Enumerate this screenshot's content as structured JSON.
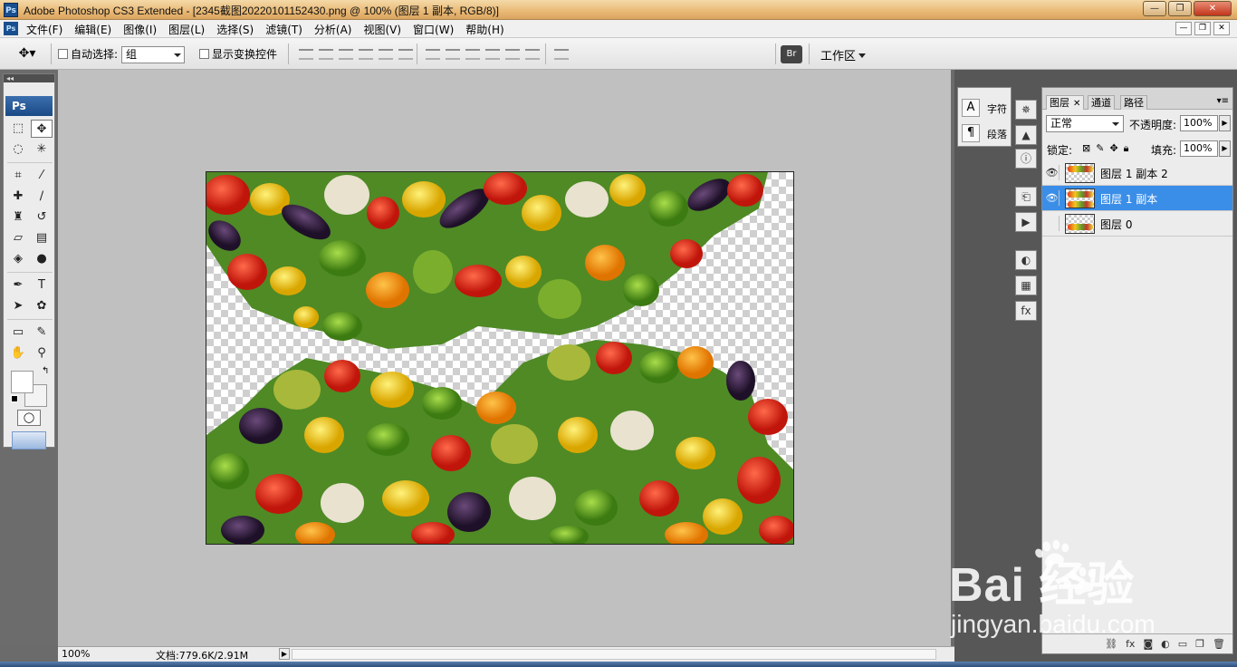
{
  "window": {
    "title": "Adobe Photoshop CS3 Extended - [2345截图20220101152430.png @ 100% (图层 1 副本, RGB/8)]",
    "app_icon": "Ps",
    "controls": [
      "—",
      "❐",
      "✕"
    ]
  },
  "menubar": {
    "items": [
      "文件(F)",
      "编辑(E)",
      "图像(I)",
      "图层(L)",
      "选择(S)",
      "滤镜(T)",
      "分析(A)",
      "视图(V)",
      "窗口(W)",
      "帮助(H)"
    ],
    "doc_controls": [
      "—",
      "❐",
      "✕"
    ]
  },
  "options": {
    "auto_select_label": "自动选择:",
    "auto_select_value": "组",
    "show_transform_label": "显示变换控件",
    "workspace_label": "工作区"
  },
  "toolbox": {
    "logo": "Ps",
    "tools": [
      {
        "name": "marquee-tool-icon",
        "glyph": "⬚"
      },
      {
        "name": "move-tool-icon",
        "glyph": "✥",
        "active": true
      },
      {
        "name": "lasso-tool-icon",
        "glyph": "◌"
      },
      {
        "name": "magic-wand-tool-icon",
        "glyph": "✳"
      },
      {
        "name": "crop-tool-icon",
        "glyph": "⌗"
      },
      {
        "name": "slice-tool-icon",
        "glyph": "⁄"
      },
      {
        "name": "healing-brush-tool-icon",
        "glyph": "✚"
      },
      {
        "name": "brush-tool-icon",
        "glyph": "∕"
      },
      {
        "name": "clone-stamp-tool-icon",
        "glyph": "♜"
      },
      {
        "name": "history-brush-tool-icon",
        "glyph": "↺"
      },
      {
        "name": "eraser-tool-icon",
        "glyph": "▱"
      },
      {
        "name": "gradient-tool-icon",
        "glyph": "▤"
      },
      {
        "name": "blur-tool-icon",
        "glyph": "◈"
      },
      {
        "name": "dodge-tool-icon",
        "glyph": "●"
      },
      {
        "name": "pen-tool-icon",
        "glyph": "✒"
      },
      {
        "name": "type-tool-icon",
        "glyph": "T"
      },
      {
        "name": "path-selection-tool-icon",
        "glyph": "➤"
      },
      {
        "name": "custom-shape-tool-icon",
        "glyph": "✿"
      },
      {
        "name": "notes-tool-icon",
        "glyph": "▭"
      },
      {
        "name": "eyedropper-tool-icon",
        "glyph": "✎"
      },
      {
        "name": "hand-tool-icon",
        "glyph": "✋"
      },
      {
        "name": "zoom-tool-icon",
        "glyph": "⚲"
      }
    ]
  },
  "statusbar": {
    "zoom": "100%",
    "doc_info": "文档:779.6K/2.91M"
  },
  "mini_panel": {
    "character_label": "字符",
    "paragraph_label": "段落"
  },
  "layers_panel": {
    "tabs": [
      "图层",
      "通道",
      "路径"
    ],
    "blend_mode": "正常",
    "opacity_label": "不透明度:",
    "opacity_value": "100%",
    "lock_label": "锁定:",
    "fill_label": "填充:",
    "fill_value": "100%",
    "layers": [
      {
        "name": "图层 1 副本 2",
        "visible": true,
        "selected": false
      },
      {
        "name": "图层 1 副本",
        "visible": true,
        "selected": true
      },
      {
        "name": "图层 0",
        "visible": false,
        "selected": false
      }
    ]
  },
  "watermark": {
    "brand": "Bai  经验",
    "site": "jingyan.baidu.com"
  }
}
